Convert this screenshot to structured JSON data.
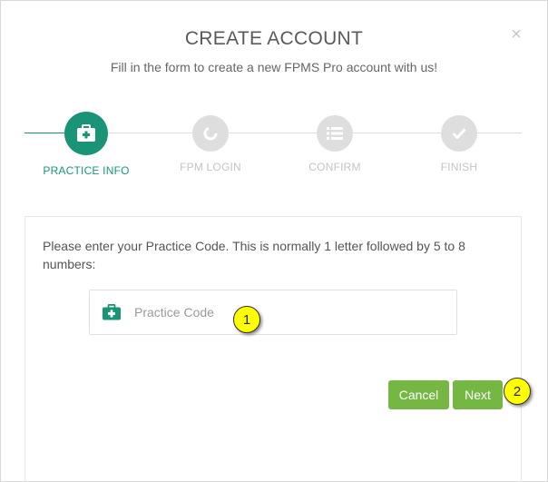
{
  "dialog": {
    "title": "CREATE ACCOUNT",
    "subtitle": "Fill in the form to create a new FPMS Pro account with us!",
    "close_icon": "×"
  },
  "stepper": {
    "steps": [
      {
        "label": "PRACTICE INFO",
        "icon": "medkit-icon",
        "state": "active"
      },
      {
        "label": "FPM LOGIN",
        "icon": "spinner-icon",
        "state": "inactive"
      },
      {
        "label": "CONFIRM",
        "icon": "list-icon",
        "state": "inactive"
      },
      {
        "label": "FINISH",
        "icon": "check-icon",
        "state": "inactive"
      }
    ]
  },
  "form": {
    "instructions": "Please enter your Practice Code. This is normally 1 letter followed by 5 to 8 numbers:",
    "practice_code": {
      "placeholder": "Practice Code",
      "value": "",
      "icon": "medkit-icon"
    }
  },
  "buttons": {
    "cancel": "Cancel",
    "next": "Next"
  },
  "callouts": [
    "1",
    "2"
  ],
  "colors": {
    "primary": "#1a9477",
    "button": "#74b843",
    "inactive_step": "#dedede",
    "callout": "#ffff00"
  }
}
